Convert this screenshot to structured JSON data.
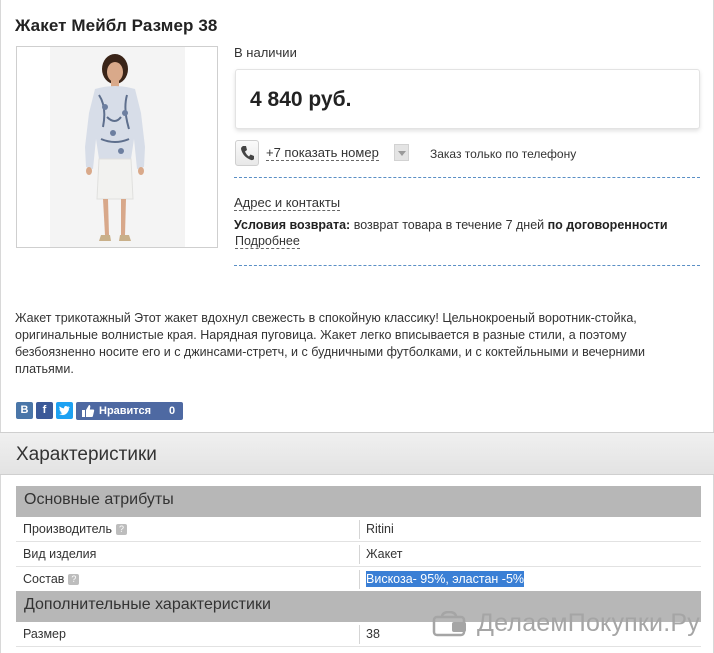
{
  "product": {
    "title": "Жакет Мейбл Размер 38",
    "stock_status": "В наличии",
    "price": "4 840 руб."
  },
  "phone": {
    "link_label": "+7 показать номер",
    "note": "Заказ только по телефону"
  },
  "info": {
    "contacts_link": "Адрес и контакты",
    "returns_label": "Условия возврата:",
    "returns_text": "возврат товара в течение 7 дней",
    "returns_bold": "по договоренности",
    "more_link": "Подробнее"
  },
  "description": "Жакет трикотажный Этот жакет вдохнул свежесть в спокойную классику! Цельнокроеный воротник-стойка, оригинальные волнистые края. Нарядная пуговица. Жакет легко вписывается в разные стили, а поэтому безбоязненно носите его и с джинсами-стретч, и с будничными футболками, и с коктейльными и вечерними платьями.",
  "social": {
    "vk": "В",
    "fb": "f",
    "like_label": "Нравится",
    "like_count": "0"
  },
  "characteristics": {
    "title": "Характеристики",
    "groups": [
      {
        "title": "Основные атрибуты",
        "rows": [
          {
            "key": "Производитель",
            "help": "?",
            "value": "Ritini"
          },
          {
            "key": "Вид изделия",
            "value": "Жакет"
          },
          {
            "key": "Состав",
            "help": "?",
            "value": "Вискоза- 95%, эластан -5%"
          }
        ]
      },
      {
        "title": "Дополнительные характеристики",
        "rows": [
          {
            "key": "Размер",
            "value": "38"
          }
        ]
      }
    ]
  },
  "watermark": "ДелаемПокупки.Ру",
  "colors": {
    "link_dash": "#5a8fc5",
    "group_bg": "#b7b7b7",
    "selection": "#3a7fd5",
    "like_bg": "#4e69a2"
  }
}
